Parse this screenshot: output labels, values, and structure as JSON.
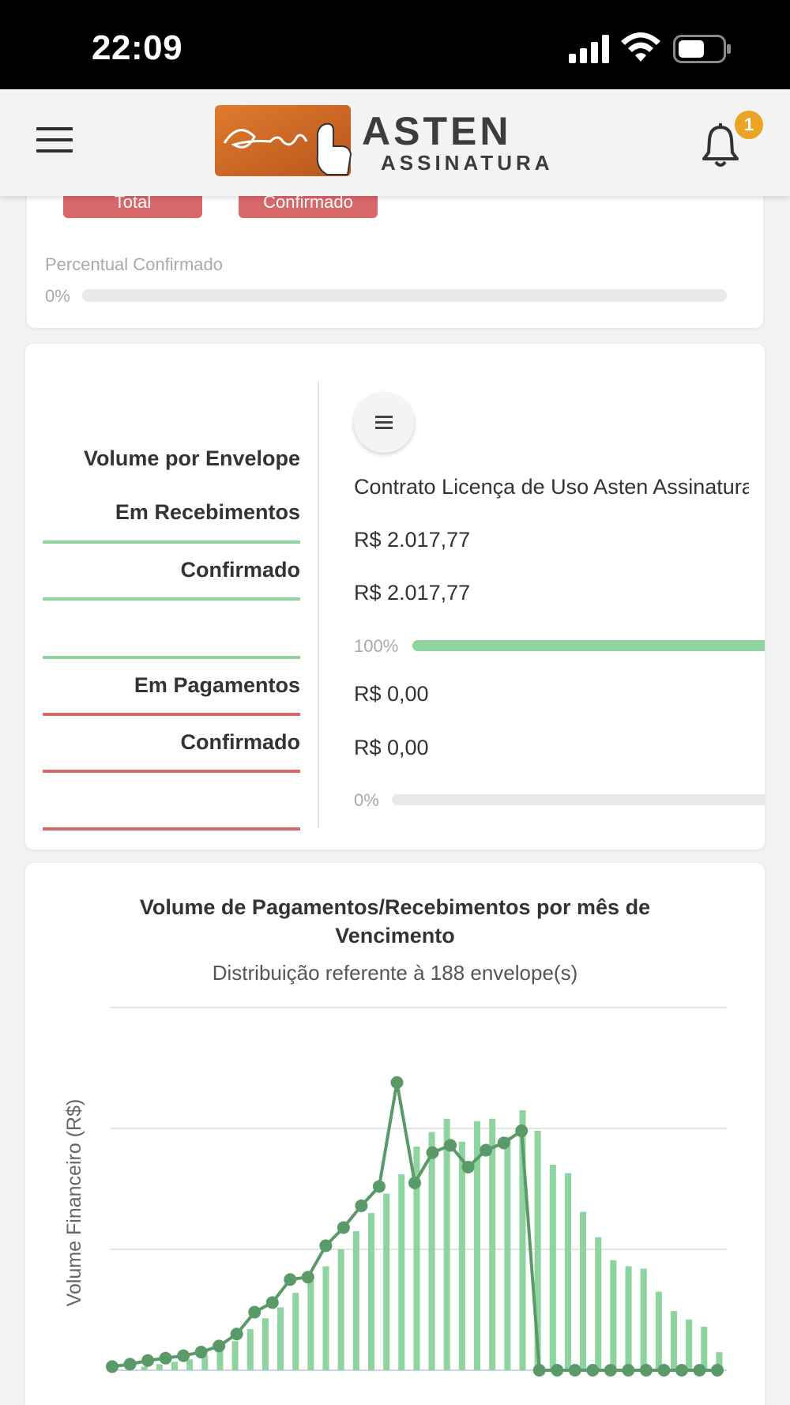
{
  "status_bar": {
    "time": "22:09"
  },
  "header": {
    "brand_line1": "ASTEN",
    "brand_line2": "ASSINATURA",
    "notifications_count": "1"
  },
  "summary_card": {
    "pill_total": "Total",
    "pill_confirmed": "Confirmado",
    "percent_label": "Percentual Confirmado",
    "percent_value": "0%",
    "percent_fill": 0
  },
  "envelope_card": {
    "labels": {
      "volume": "Volume por Envelope",
      "receipts": "Em Recebimentos",
      "receipts_confirmed": "Confirmado",
      "payments": "Em Pagamentos",
      "payments_confirmed": "Confirmado"
    },
    "envelope_name": "Contrato Licença de Uso Asten Assinatura",
    "receipts_value": "R$ 2.017,77",
    "receipts_confirmed_value": "R$ 2.017,77",
    "receipts_percent": "100%",
    "receipts_fill": 1,
    "payments_value": "R$ 0,00",
    "payments_confirmed_value": "R$ 0,00",
    "payments_percent": "0%",
    "payments_fill": 0
  },
  "chart_card": {
    "title": "Volume de Pagamentos/Recebimentos por mês de Vencimento",
    "subtitle": "Distribuição referente à 188 envelope(s)"
  },
  "chart_data": {
    "type": "bar",
    "title": "Volume de Pagamentos/Recebimentos por mês de Vencimento",
    "subtitle": "Distribuição referente à 188 envelope(s)",
    "ylabel": "Volume Financeiro (R$)",
    "xlabel": "",
    "ylim": [
      0,
      3
    ],
    "grid": true,
    "colors": {
      "bars": "#8fd3a0",
      "line": "#5a9a68"
    },
    "bars": [
      0.02,
      0.03,
      0.05,
      0.07,
      0.09,
      0.12,
      0.16,
      0.24,
      0.34,
      0.43,
      0.52,
      0.64,
      0.74,
      0.86,
      1.0,
      1.15,
      1.3,
      1.46,
      1.62,
      1.85,
      1.97,
      2.08,
      1.89,
      2.06,
      2.08,
      1.93,
      2.15,
      1.98,
      1.7,
      1.63,
      1.31,
      1.1,
      0.91,
      0.86,
      0.84,
      0.65,
      0.49,
      0.42,
      0.36,
      0.15
    ],
    "line": [
      0.03,
      0.05,
      0.08,
      0.1,
      0.12,
      0.15,
      0.2,
      0.3,
      0.48,
      0.56,
      0.75,
      0.77,
      1.03,
      1.18,
      1.36,
      1.52,
      2.38,
      1.55,
      1.8,
      1.86,
      1.68,
      1.82,
      1.88,
      1.98,
      0.0,
      0.0,
      0.0,
      0.0,
      0.0,
      0.0,
      0.0,
      0.0,
      0.0,
      0.0,
      0.0
    ]
  }
}
